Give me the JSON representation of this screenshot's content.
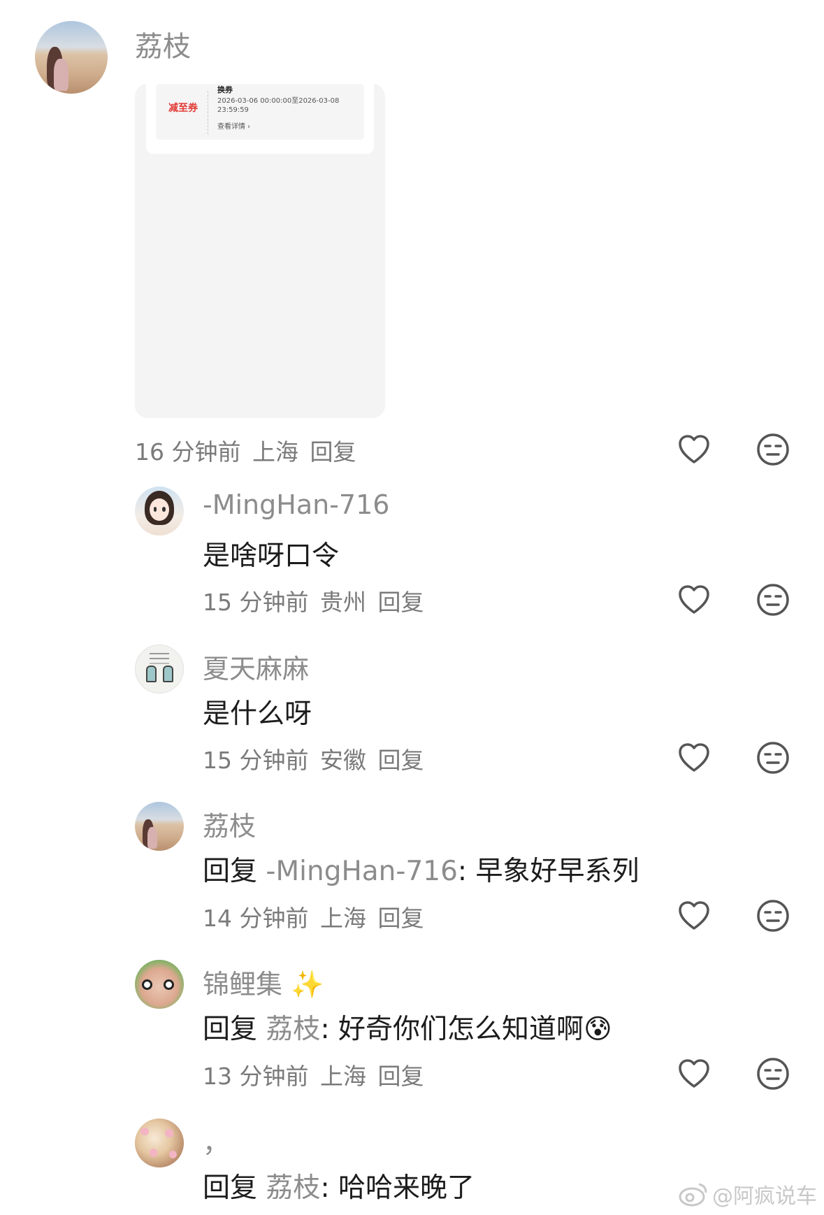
{
  "comments": [
    {
      "name": "荔枝",
      "time": "16 分钟前",
      "location": "上海",
      "reply_label": "回复",
      "image_card": {
        "title": "换券",
        "tag": "减至券",
        "period": "2026-03-06 00:00:00至2026-03-08 23:59:59",
        "detail_link": "查看详情 ›"
      }
    },
    {
      "name": "-MingHan-716",
      "text": "是啥呀口令",
      "time": "15 分钟前",
      "location": "贵州",
      "reply_label": "回复"
    },
    {
      "name": "夏天麻麻",
      "text": "是什么呀",
      "time": "15 分钟前",
      "location": "安徽",
      "reply_label": "回复"
    },
    {
      "name": "荔枝",
      "prefix": "回复",
      "mention": "-MingHan-716",
      "text": ": 早象好早系列",
      "time": "14 分钟前",
      "location": "上海",
      "reply_label": "回复"
    },
    {
      "name": "锦鲤集",
      "name_emoji": "✨",
      "prefix": "回复",
      "mention": "荔枝",
      "text": ": 好奇你们怎么知道啊",
      "text_emoji": "😰",
      "time": "13 分钟前",
      "location": "上海",
      "reply_label": "回复"
    },
    {
      "name": "，",
      "prefix": "回复",
      "mention": "荔枝",
      "text": ": 哈哈来晚了"
    }
  ],
  "icons": {
    "like": "heart-outline-icon",
    "reaction": "neutral-face-icon",
    "watermark_logo": "weibo-logo-icon"
  },
  "colors": {
    "name_gray": "#8c8c8c",
    "text": "#1c1c1c",
    "coupon_red": "#e23a35"
  },
  "watermark": "@阿疯说车"
}
